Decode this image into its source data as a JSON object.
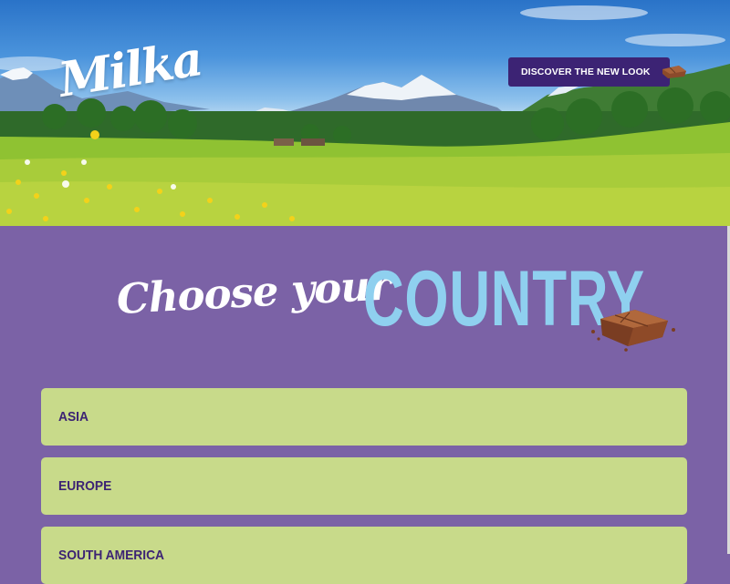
{
  "hero": {
    "logo_text": "Milka",
    "discover_button_label": "DISCOVER THE NEW LOOK"
  },
  "heading": {
    "choose": "Choose your",
    "country": "COUNTRY"
  },
  "regions": [
    {
      "label": "ASIA"
    },
    {
      "label": "EUROPE"
    },
    {
      "label": "SOUTH AMERICA"
    }
  ],
  "colors": {
    "brand_purple": "#7b62a6",
    "button_dark_purple": "#3c2374",
    "country_blue": "#8fd0ef",
    "region_green": "#c8da8a"
  },
  "icons": {
    "button_icon": "chocolate-piece-icon",
    "heading_decoration": "chocolate-piece-icon"
  }
}
